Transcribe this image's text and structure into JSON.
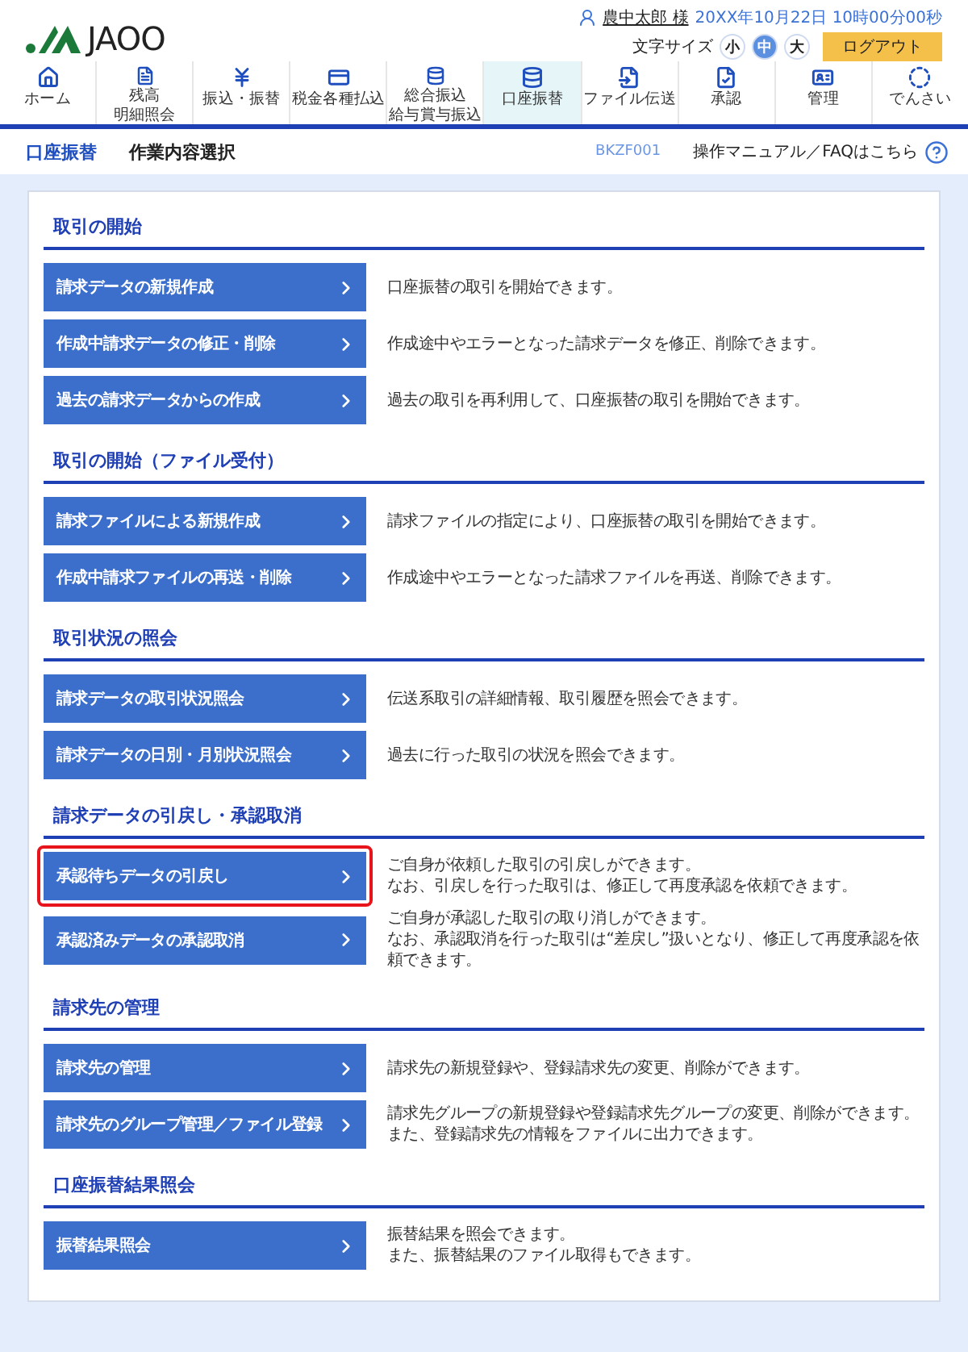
{
  "header": {
    "logo": "JAOO",
    "user_name": "農中太郎 様",
    "datetime": "20XX年10月22日 10時00分00秒",
    "font_size_label": "文字サイズ",
    "font_sizes": [
      {
        "label": "小",
        "selected": false
      },
      {
        "label": "中",
        "selected": true
      },
      {
        "label": "大",
        "selected": false
      }
    ],
    "logout": "ログアウト"
  },
  "nav": [
    {
      "lines": [
        "ホーム"
      ],
      "selected": false
    },
    {
      "lines": [
        "残高",
        "明細照会"
      ],
      "selected": false
    },
    {
      "lines": [
        "振込・振替"
      ],
      "selected": false
    },
    {
      "lines": [
        "税金各種払込"
      ],
      "selected": false
    },
    {
      "lines": [
        "総合振込",
        "給与賞与振込"
      ],
      "selected": false
    },
    {
      "lines": [
        "口座振替"
      ],
      "selected": true
    },
    {
      "lines": [
        "ファイル伝送"
      ],
      "selected": false
    },
    {
      "lines": [
        "承認"
      ],
      "selected": false
    },
    {
      "lines": [
        "管理"
      ],
      "selected": false
    },
    {
      "lines": [
        "でんさい"
      ],
      "selected": false
    }
  ],
  "title_bar": {
    "section": "口座振替",
    "page": "作業内容選択",
    "screen_id": "BKZF001",
    "help": "操作マニュアル／FAQはこちら"
  },
  "sections": [
    {
      "heading": "取引の開始",
      "items": [
        {
          "button": "請求データの新規作成",
          "highlighted": false,
          "description": [
            "口座振替の取引を開始できます。"
          ]
        },
        {
          "button": "作成中請求データの修正・削除",
          "highlighted": false,
          "description": [
            "作成途中やエラーとなった請求データを修正、削除できます。"
          ]
        },
        {
          "button": "過去の請求データからの作成",
          "highlighted": false,
          "description": [
            "過去の取引を再利用して、口座振替の取引を開始できます。"
          ]
        }
      ]
    },
    {
      "heading": "取引の開始（ファイル受付）",
      "items": [
        {
          "button": "請求ファイルによる新規作成",
          "highlighted": false,
          "description": [
            "請求ファイルの指定により、口座振替の取引を開始できます。"
          ]
        },
        {
          "button": "作成中請求ファイルの再送・削除",
          "highlighted": false,
          "description": [
            "作成途中やエラーとなった請求ファイルを再送、削除できます。"
          ]
        }
      ]
    },
    {
      "heading": "取引状況の照会",
      "items": [
        {
          "button": "請求データの取引状況照会",
          "highlighted": false,
          "description": [
            "伝送系取引の詳細情報、取引履歴を照会できます。"
          ]
        },
        {
          "button": "請求データの日別・月別状況照会",
          "highlighted": false,
          "description": [
            "過去に行った取引の状況を照会できます。"
          ]
        }
      ]
    },
    {
      "heading": "請求データの引戻し・承認取消",
      "items": [
        {
          "button": "承認待ちデータの引戻し",
          "highlighted": true,
          "description": [
            "ご自身が依頼した取引の引戻しができます。",
            "なお、引戻しを行った取引は、修正して再度承認を依頼できます。"
          ]
        },
        {
          "button": "承認済みデータの承認取消",
          "highlighted": false,
          "description": [
            "ご自身が承認した取引の取り消しができます。",
            "なお、承認取消を行った取引は“差戻し”扱いとなり、修正して再度承認を依頼できます。"
          ]
        }
      ]
    },
    {
      "heading": "請求先の管理",
      "items": [
        {
          "button": "請求先の管理",
          "highlighted": false,
          "description": [
            "請求先の新規登録や、登録請求先の変更、削除ができます。"
          ]
        },
        {
          "button": "請求先のグループ管理／ファイル登録",
          "highlighted": false,
          "description": [
            "請求先グループの新規登録や登録請求先グループの変更、削除ができます。",
            "また、登録請求先の情報をファイルに出力できます。"
          ]
        }
      ]
    },
    {
      "heading": "口座振替結果照会",
      "items": [
        {
          "button": "振替結果照会",
          "highlighted": false,
          "description": [
            "振替結果を照会できます。",
            "また、振替結果のファイル取得もできます。"
          ]
        }
      ]
    }
  ]
}
